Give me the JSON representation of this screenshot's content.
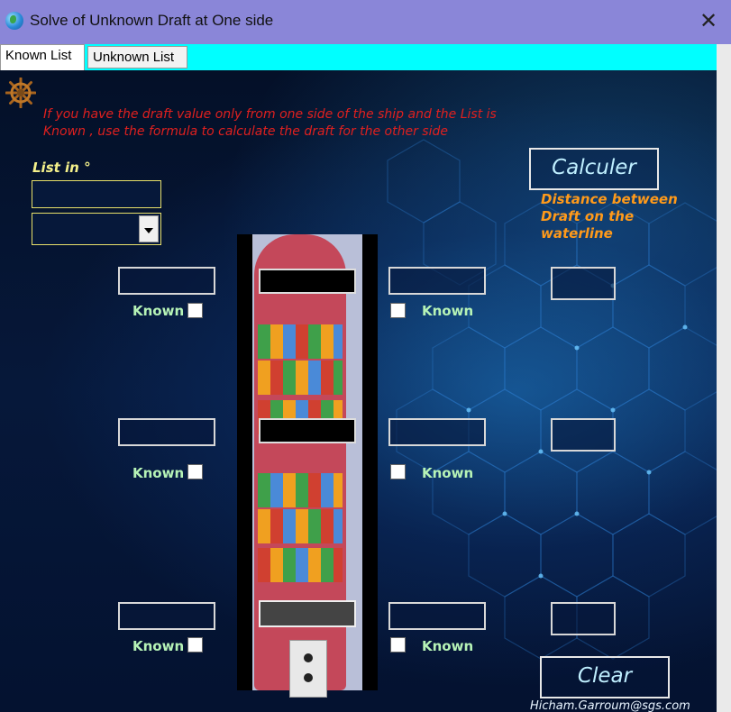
{
  "window": {
    "title": "Solve of Unknown Draft at One side",
    "close_symbol": "✕"
  },
  "tabs": [
    {
      "label": "Known List",
      "active": true
    },
    {
      "label": "Unknown List",
      "active": false
    }
  ],
  "info_text_line1": "If you have the draft value only from one side of the ship and the List is",
  "info_text_line2": "Known  , use the formula to calculate the draft for the other side",
  "list_label": "List in °",
  "list_input_value": "",
  "list_dropdown_value": "",
  "calculer_label": "Calculer",
  "distance_line1": "Distance between",
  "distance_line2": "Draft on the",
  "distance_line3": "waterline",
  "known_label": "Known",
  "clear_label": "Clear",
  "email": "Hicham.Garroum@sgs.com",
  "colors": {
    "titlebar": "#8a86d8",
    "tabstrip": "#00ffff",
    "info_text": "#e0201f",
    "list_label": "#f4f08a",
    "distance_text": "#ff9a1a",
    "known_text": "#b6f3b6",
    "button_text": "#bfefff"
  },
  "icons": {
    "window": "globe-icon",
    "close": "close-icon",
    "logo": "ship-wheel-icon",
    "dropdown": "chevron-down-icon"
  }
}
